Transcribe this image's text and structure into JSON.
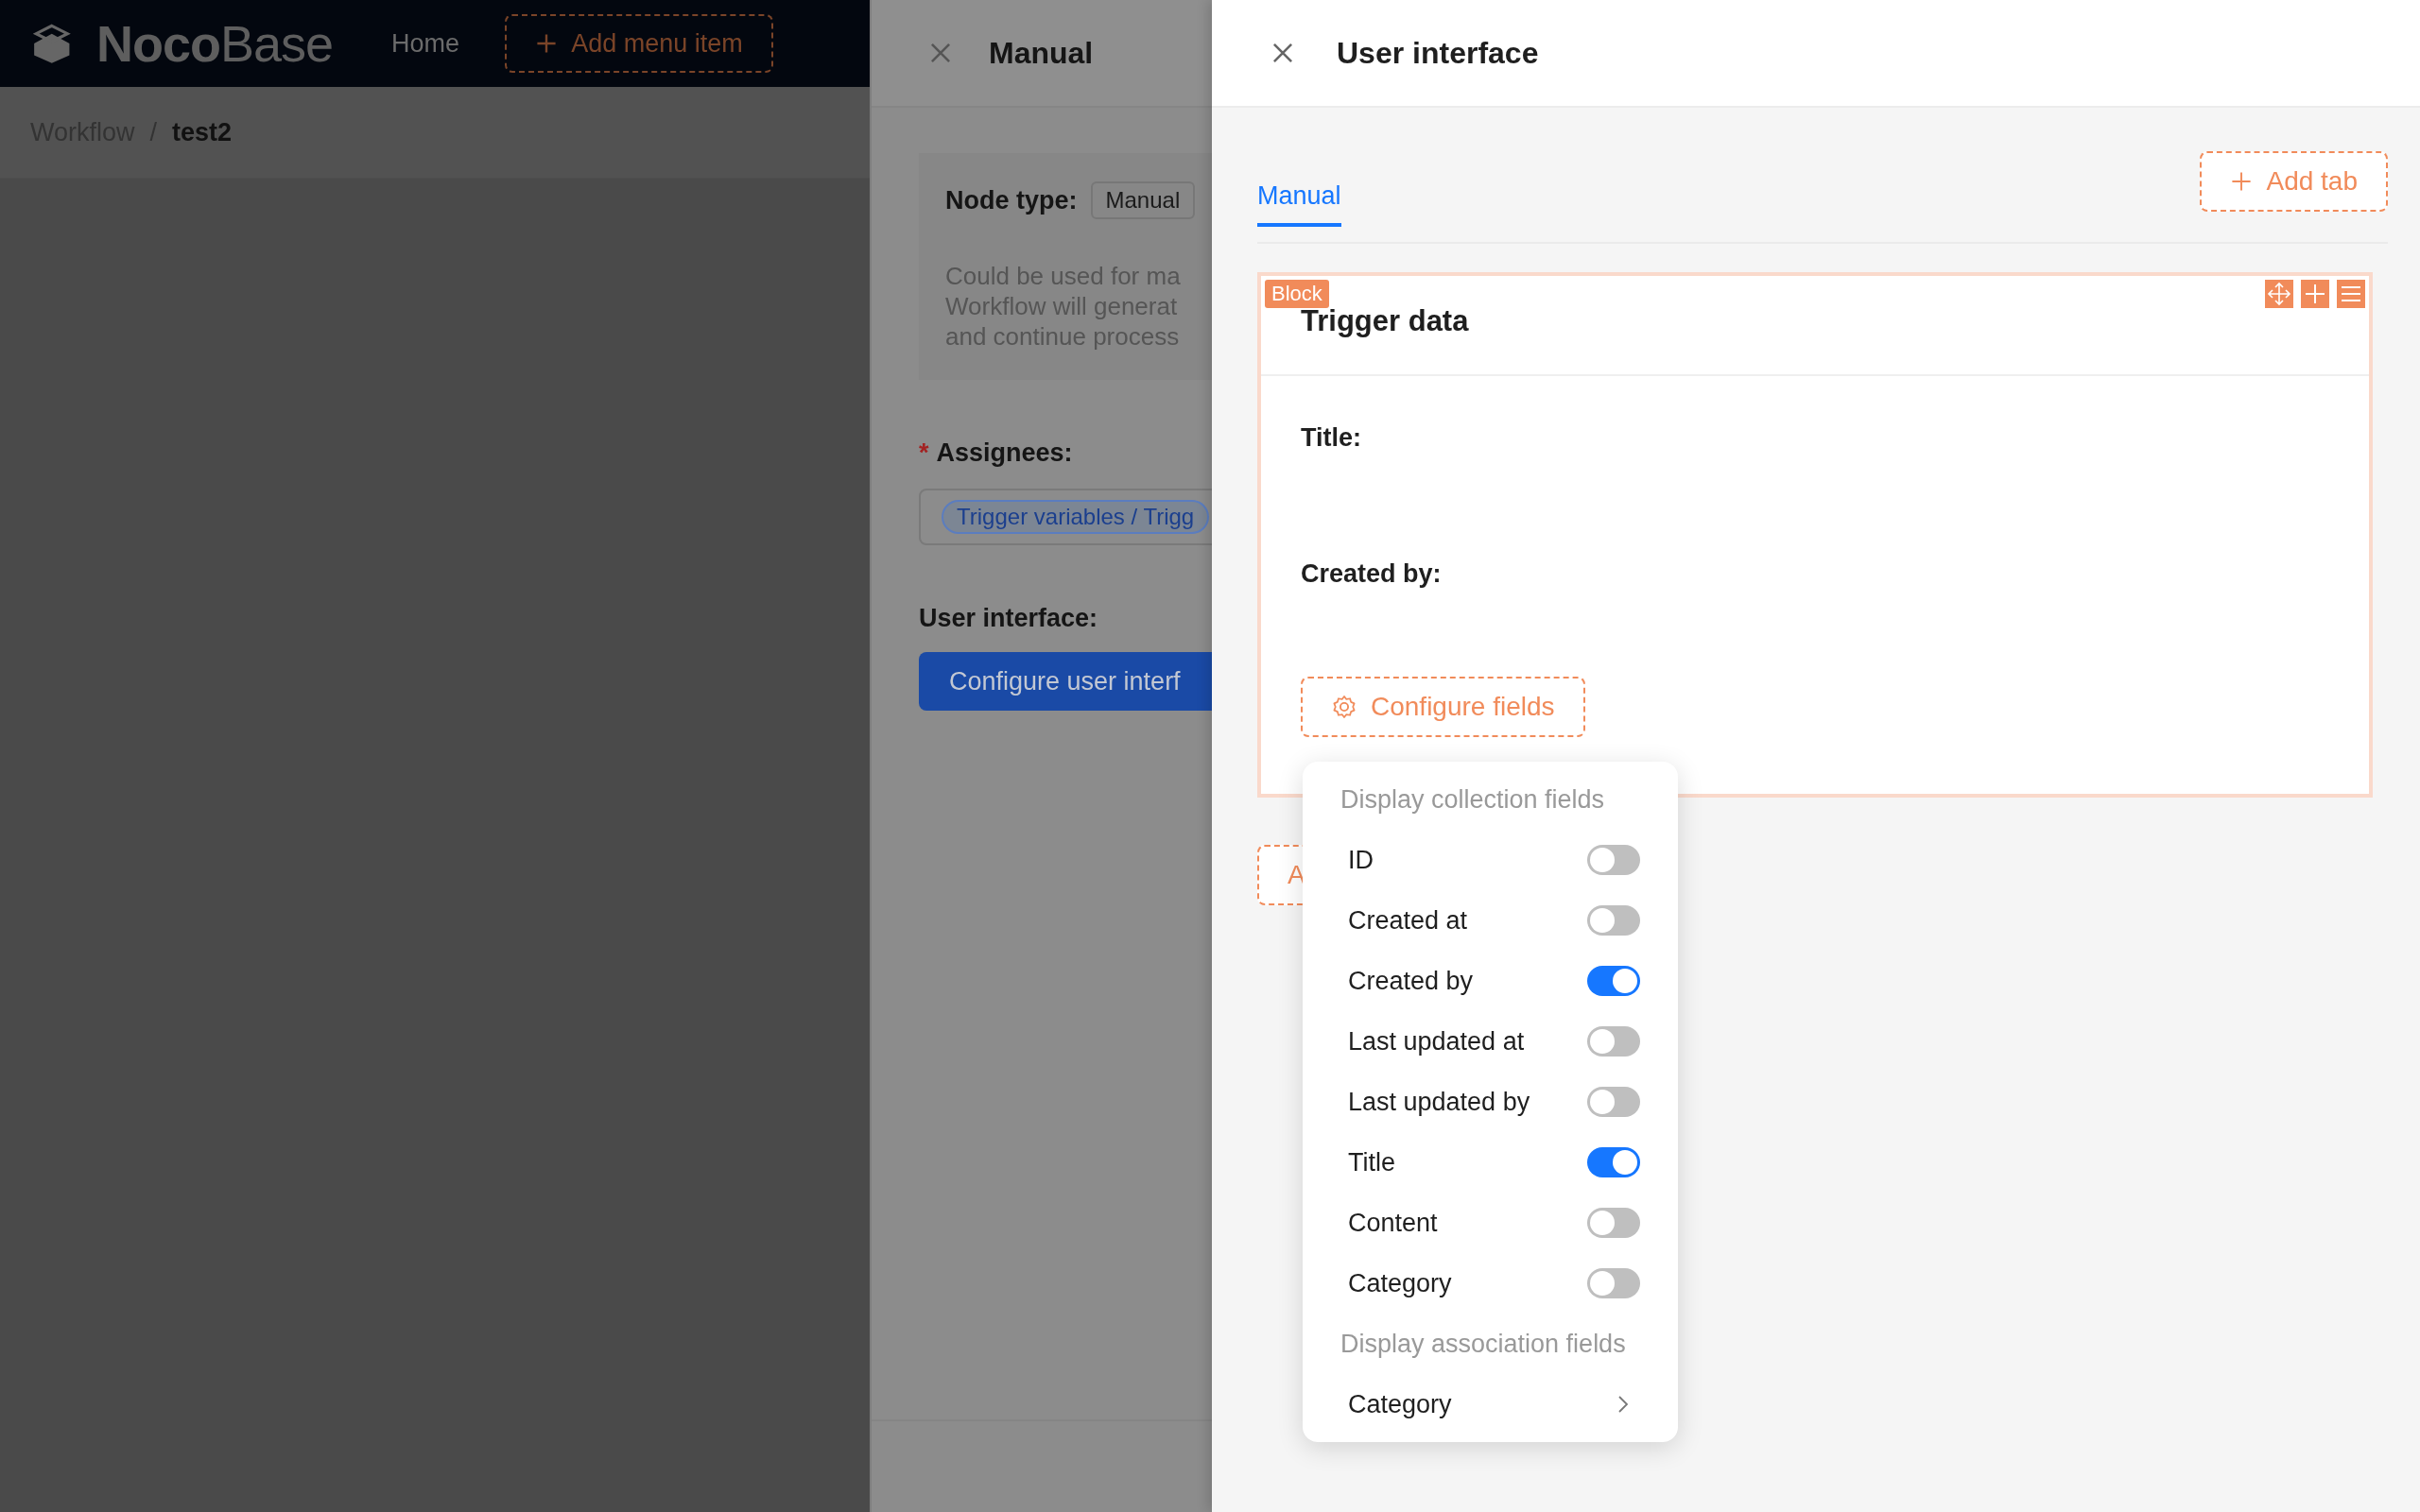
{
  "app_header": {
    "logo": "**Noco**Base",
    "nav": [
      {
        "label": "Home"
      }
    ],
    "add_menu_item": "Add menu item"
  },
  "breadcrumb": {
    "separator": "/",
    "items": [
      {
        "label": "Workflow"
      },
      {
        "label": "test2"
      }
    ]
  },
  "manual_drawer": {
    "title": "Manual",
    "node_type_label": "Node type:",
    "node_type": "Manual",
    "description": [
      "Could be used for ma",
      "Workflow will generat",
      "and continue process"
    ],
    "assignees_label": "Assignees:",
    "required": true,
    "required_mark": "*",
    "assignee_tag": "Trigger variables / Trigg",
    "ui_label": "User interface:",
    "configure_button": "Configure user interf"
  },
  "ui_drawer": {
    "title": "User interface",
    "tabs": [
      {
        "label": "Manual",
        "selected": true
      }
    ],
    "add_tab": "Add tab",
    "block": {
      "badge": "Block",
      "title": "Trigger data",
      "fields": [
        {
          "label": "Title:"
        },
        {
          "label": "Created by:"
        }
      ],
      "configure_fields": "Configure fields"
    },
    "add_block_button": "A"
  },
  "fields_menu": {
    "groups": [
      {
        "heading": "Display collection fields",
        "items": [
          {
            "label": "ID",
            "kind": "switch",
            "on": false
          },
          {
            "label": "Created at",
            "kind": "switch",
            "on": false
          },
          {
            "label": "Created by",
            "kind": "switch",
            "on": true
          },
          {
            "label": "Last updated at",
            "kind": "switch",
            "on": false
          },
          {
            "label": "Last updated by",
            "kind": "switch",
            "on": false
          },
          {
            "label": "Title",
            "kind": "switch",
            "on": true
          },
          {
            "label": "Content",
            "kind": "switch",
            "on": false
          },
          {
            "label": "Category",
            "kind": "switch",
            "on": false
          }
        ]
      },
      {
        "heading": "Display association fields",
        "items": [
          {
            "label": "Category",
            "kind": "submenu"
          }
        ]
      }
    ]
  }
}
